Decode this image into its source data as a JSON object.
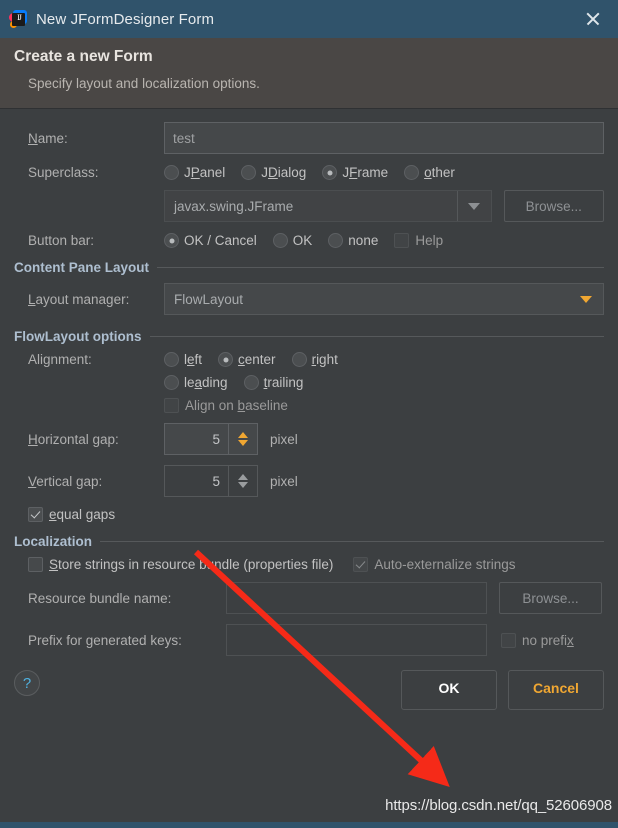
{
  "window": {
    "title": "New JFormDesigner Form",
    "icon": "intellij-idea-icon",
    "close_label": "×"
  },
  "banner": {
    "title": "Create a new Form",
    "subtitle": "Specify layout and localization options."
  },
  "form": {
    "name_label": "Name:",
    "name_value": "test",
    "name_placeholder": "",
    "superclass_label": "Superclass:",
    "superclass_options": [
      {
        "label": "JPanel",
        "mnemonic": "P",
        "selected": false
      },
      {
        "label": "JDialog",
        "mnemonic": "D",
        "selected": false
      },
      {
        "label": "JFrame",
        "mnemonic": "F",
        "selected": true
      },
      {
        "label": "other",
        "mnemonic": "o",
        "selected": false
      }
    ],
    "superclass_combo_value": "javax.swing.JFrame",
    "browse_label": "Browse...",
    "buttonbar_label": "Button bar:",
    "buttonbar_options": [
      {
        "label": "OK / Cancel",
        "selected": true
      },
      {
        "label": "OK",
        "selected": false
      },
      {
        "label": "none",
        "selected": false
      }
    ],
    "help_checkbox_label": "Help",
    "help_checkbox_checked": false
  },
  "content_pane": {
    "section_title": "Content Pane Layout",
    "layout_manager_label": "Layout manager:",
    "layout_manager_value": "FlowLayout"
  },
  "flow_options": {
    "section_title": "FlowLayout options",
    "alignment_label": "Alignment:",
    "alignment_row1": [
      {
        "label": "left",
        "mnemonic": "e",
        "selected": false
      },
      {
        "label": "center",
        "mnemonic": "c",
        "selected": true
      },
      {
        "label": "right",
        "mnemonic": "r",
        "selected": false
      }
    ],
    "alignment_row2": [
      {
        "label": "leading",
        "mnemonic": "a",
        "selected": false
      },
      {
        "label": "trailing",
        "mnemonic": "t",
        "selected": false
      }
    ],
    "align_baseline_label": "Align on baseline",
    "align_baseline_checked": false,
    "hgap_label": "Horizontal gap:",
    "hgap_value": "5",
    "hgap_unit": "pixel",
    "vgap_label": "Vertical gap:",
    "vgap_value": "5",
    "vgap_unit": "pixel",
    "equal_gaps_label": "equal gaps",
    "equal_gaps_checked": true
  },
  "localization": {
    "section_title": "Localization",
    "store_strings_label": "Store strings in resource bundle (properties file)",
    "store_strings_checked": false,
    "auto_externalize_label": "Auto-externalize strings",
    "auto_externalize_checked": true,
    "bundle_name_label": "Resource bundle name:",
    "bundle_name_value": "",
    "bundle_browse_label": "Browse...",
    "prefix_label": "Prefix for generated keys:",
    "prefix_value": "",
    "no_prefix_label": "no prefix",
    "no_prefix_checked": false
  },
  "footer": {
    "help_icon": "question-mark-icon",
    "ok_label": "OK",
    "cancel_label": "Cancel"
  },
  "annotation": {
    "watermark": "https://blog.csdn.net/qq_52606908",
    "arrow_color": "#f52a18"
  },
  "colors": {
    "titlebar": "#30536b",
    "banner": "#4a4745",
    "body": "#3c3f41",
    "accent_amber": "#f0a732",
    "section_header": "#aebfd0",
    "cancel_text": "#f0a732"
  }
}
